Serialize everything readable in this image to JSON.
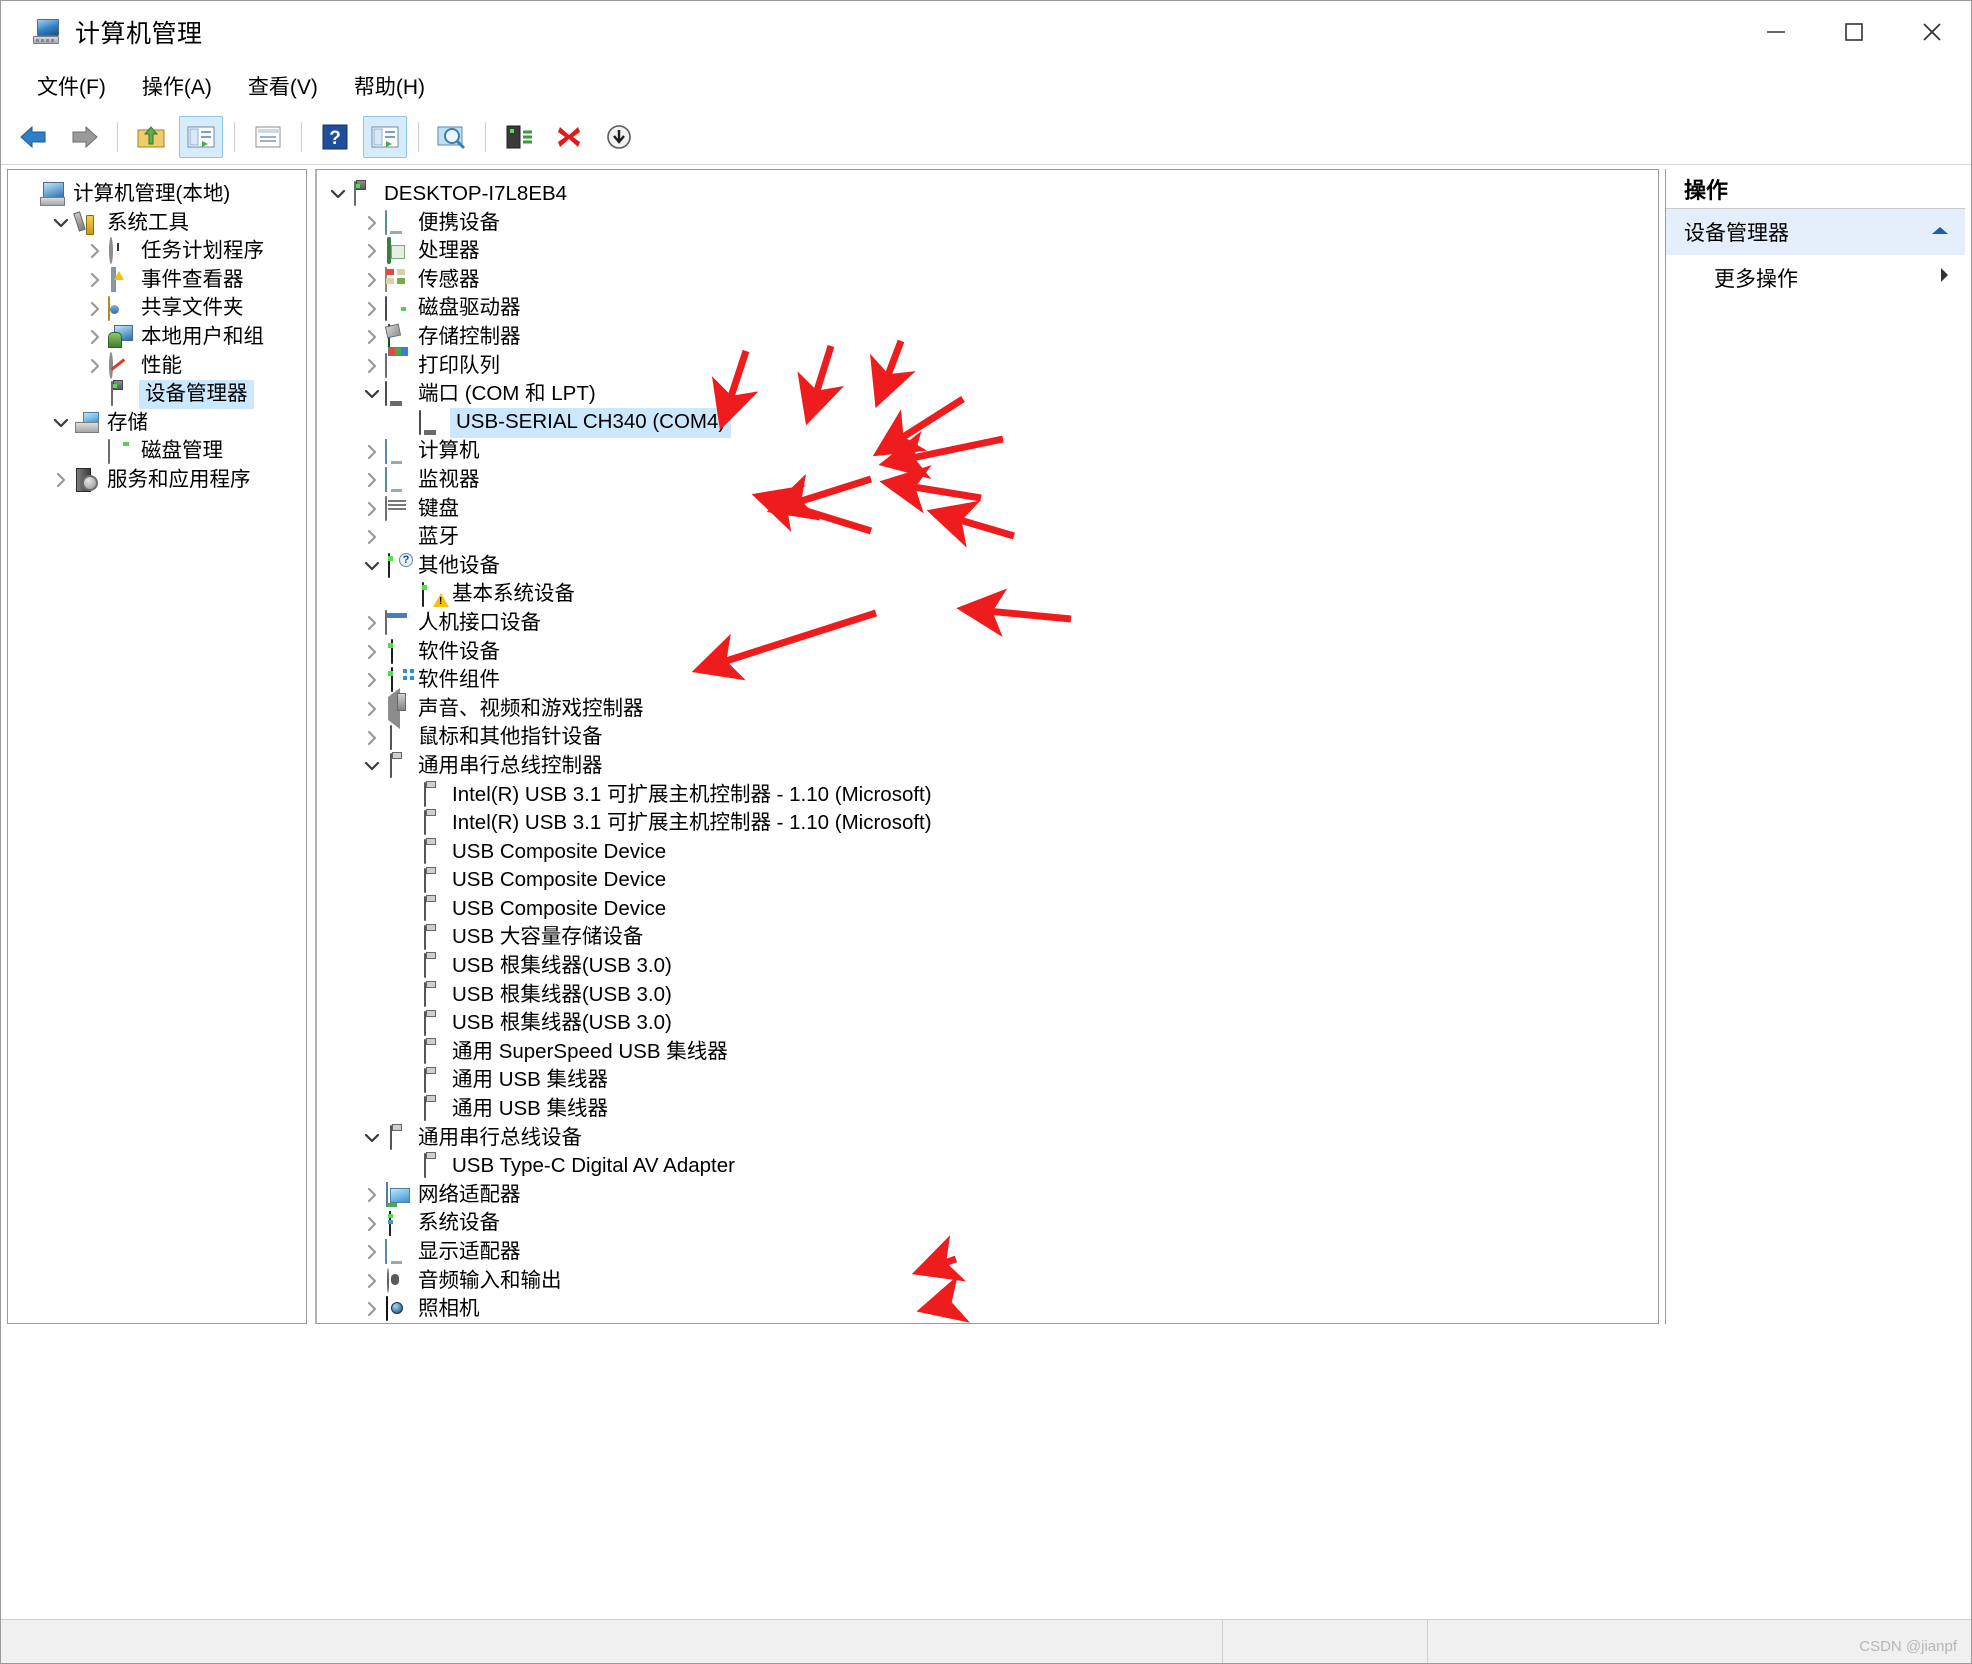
{
  "window": {
    "title": "计算机管理",
    "icon": "computer-management-icon",
    "minimize": "−",
    "maximize": "□",
    "close": "✕"
  },
  "menubar": {
    "items": [
      {
        "label": "文件(F)",
        "name": "menu-file"
      },
      {
        "label": "操作(A)",
        "name": "menu-action"
      },
      {
        "label": "查看(V)",
        "name": "menu-view"
      },
      {
        "label": "帮助(H)",
        "name": "menu-help"
      }
    ]
  },
  "toolbar": {
    "buttons": [
      {
        "name": "back-button",
        "icon": "arrow-left-icon",
        "active": false
      },
      {
        "name": "forward-button",
        "icon": "arrow-right-icon",
        "active": false
      },
      {
        "name": "up-one-level-button",
        "icon": "folder-up-icon",
        "active": false
      },
      {
        "name": "show-console-tree-button",
        "icon": "console-tree-icon",
        "active": true
      },
      {
        "name": "properties-button",
        "icon": "properties-window-icon",
        "active": false
      },
      {
        "name": "help-button",
        "icon": "question-mark-icon",
        "active": false
      },
      {
        "name": "show-hidden-devices-button",
        "icon": "list-view-icon",
        "active": true
      },
      {
        "name": "scan-hardware-changes-button",
        "icon": "magnifier-scan-icon",
        "active": false
      },
      {
        "name": "update-driver-button",
        "icon": "update-driver-icon",
        "active": false
      },
      {
        "name": "uninstall-device-button",
        "icon": "red-x-icon",
        "active": false
      },
      {
        "name": "disable-device-button",
        "icon": "down-arrow-circle-icon",
        "active": false
      }
    ]
  },
  "sidebar": {
    "items": [
      {
        "label": "计算机管理(本地)",
        "name": "sidebar-computer-management-local",
        "indent": 0,
        "chev": "none",
        "icon": "ic-cmgmt",
        "selected": false
      },
      {
        "label": "系统工具",
        "name": "sidebar-system-tools",
        "indent": 1,
        "chev": "down",
        "icon": "ic-tools",
        "selected": false
      },
      {
        "label": "任务计划程序",
        "name": "sidebar-task-scheduler",
        "indent": 2,
        "chev": "right",
        "icon": "ic-clock",
        "selected": false
      },
      {
        "label": "事件查看器",
        "name": "sidebar-event-viewer",
        "indent": 2,
        "chev": "right",
        "icon": "ic-event",
        "selected": false
      },
      {
        "label": "共享文件夹",
        "name": "sidebar-shared-folders",
        "indent": 2,
        "chev": "right",
        "icon": "ic-folder",
        "selected": false
      },
      {
        "label": "本地用户和组",
        "name": "sidebar-local-users-groups",
        "indent": 2,
        "chev": "right",
        "icon": "ic-users",
        "selected": false
      },
      {
        "label": "性能",
        "name": "sidebar-performance",
        "indent": 2,
        "chev": "right",
        "icon": "ic-perf",
        "selected": false
      },
      {
        "label": "设备管理器",
        "name": "sidebar-device-manager",
        "indent": 2,
        "chev": "none",
        "icon": "ic-devmgr",
        "selected": true
      },
      {
        "label": "存储",
        "name": "sidebar-storage",
        "indent": 1,
        "chev": "down",
        "icon": "ic-storage",
        "selected": false
      },
      {
        "label": "磁盘管理",
        "name": "sidebar-disk-management",
        "indent": 2,
        "chev": "none",
        "icon": "ic-diskmgmt",
        "selected": false
      },
      {
        "label": "服务和应用程序",
        "name": "sidebar-services-applications",
        "indent": 1,
        "chev": "right",
        "icon": "ic-services",
        "selected": false
      }
    ]
  },
  "device_tree": {
    "items": [
      {
        "label": "DESKTOP-I7L8EB4",
        "name": "device-node-desktop",
        "indent": 0,
        "chev": "down",
        "icon": "ic-devmgr",
        "selected": false
      },
      {
        "label": "便携设备",
        "name": "device-node-portable-devices",
        "indent": 1,
        "chev": "right",
        "icon": "ic-monitor",
        "selected": false
      },
      {
        "label": "处理器",
        "name": "device-node-processors",
        "indent": 1,
        "chev": "right",
        "icon": "ic-cpu",
        "selected": false
      },
      {
        "label": "传感器",
        "name": "device-node-sensors",
        "indent": 1,
        "chev": "right",
        "icon": "ic-sensor",
        "selected": false
      },
      {
        "label": "磁盘驱动器",
        "name": "device-node-disk-drives",
        "indent": 1,
        "chev": "right",
        "icon": "ic-disk",
        "selected": false
      },
      {
        "label": "存储控制器",
        "name": "device-node-storage-controllers",
        "indent": 1,
        "chev": "right",
        "icon": "ic-stgctl",
        "selected": false
      },
      {
        "label": "打印队列",
        "name": "device-node-print-queues",
        "indent": 1,
        "chev": "right",
        "icon": "ic-printer",
        "selected": false
      },
      {
        "label": "端口 (COM 和 LPT)",
        "name": "device-node-ports-com-lpt",
        "indent": 1,
        "chev": "down",
        "icon": "ic-serial",
        "selected": false
      },
      {
        "label": "USB-SERIAL CH340 (COM4)",
        "name": "device-node-usb-serial-ch340-com4",
        "indent": 2,
        "chev": "none",
        "icon": "ic-serial",
        "selected": true
      },
      {
        "label": "计算机",
        "name": "device-node-computer",
        "indent": 1,
        "chev": "right",
        "icon": "ic-display",
        "selected": false
      },
      {
        "label": "监视器",
        "name": "device-node-monitors",
        "indent": 1,
        "chev": "right",
        "icon": "ic-display",
        "selected": false
      },
      {
        "label": "键盘",
        "name": "device-node-keyboards",
        "indent": 1,
        "chev": "right",
        "icon": "ic-keyboard",
        "selected": false
      },
      {
        "label": "蓝牙",
        "name": "device-node-bluetooth",
        "indent": 1,
        "chev": "right",
        "icon": "ic-bt",
        "selected": false
      },
      {
        "label": "其他设备",
        "name": "device-node-other-devices",
        "indent": 1,
        "chev": "down",
        "icon": "ic-other-q",
        "selected": false
      },
      {
        "label": "基本系统设备",
        "name": "device-node-base-system-device",
        "indent": 2,
        "chev": "none",
        "icon": "ic-other-w",
        "selected": false
      },
      {
        "label": "人机接口设备",
        "name": "device-node-hid",
        "indent": 1,
        "chev": "right",
        "icon": "ic-hid",
        "selected": false
      },
      {
        "label": "软件设备",
        "name": "device-node-software-devices",
        "indent": 1,
        "chev": "right",
        "icon": "ic-softdev",
        "selected": false
      },
      {
        "label": "软件组件",
        "name": "device-node-software-components",
        "indent": 1,
        "chev": "right",
        "icon": "ic-softcomp",
        "selected": false
      },
      {
        "label": "声音、视频和游戏控制器",
        "name": "device-node-sound-video-game-controllers",
        "indent": 1,
        "chev": "right",
        "icon": "ic-sound",
        "selected": false
      },
      {
        "label": "鼠标和其他指针设备",
        "name": "device-node-mice-pointing-devices",
        "indent": 1,
        "chev": "right",
        "icon": "ic-mouse",
        "selected": false
      },
      {
        "label": "通用串行总线控制器",
        "name": "device-node-usb-controllers",
        "indent": 1,
        "chev": "down",
        "icon": "ic-usbport",
        "selected": false
      },
      {
        "label": "Intel(R) USB 3.1 可扩展主机控制器 - 1.10 (Microsoft)",
        "name": "device-node-intel-usb31-xhci-1",
        "indent": 2,
        "chev": "none",
        "icon": "ic-usbport",
        "selected": false
      },
      {
        "label": "Intel(R) USB 3.1 可扩展主机控制器 - 1.10 (Microsoft)",
        "name": "device-node-intel-usb31-xhci-2",
        "indent": 2,
        "chev": "none",
        "icon": "ic-usbport",
        "selected": false
      },
      {
        "label": "USB Composite Device",
        "name": "device-node-usb-composite-1",
        "indent": 2,
        "chev": "none",
        "icon": "ic-usbport",
        "selected": false
      },
      {
        "label": "USB Composite Device",
        "name": "device-node-usb-composite-2",
        "indent": 2,
        "chev": "none",
        "icon": "ic-usbport",
        "selected": false
      },
      {
        "label": "USB Composite Device",
        "name": "device-node-usb-composite-3",
        "indent": 2,
        "chev": "none",
        "icon": "ic-usbport",
        "selected": false
      },
      {
        "label": "USB 大容量存储设备",
        "name": "device-node-usb-mass-storage",
        "indent": 2,
        "chev": "none",
        "icon": "ic-usbport",
        "selected": false
      },
      {
        "label": "USB 根集线器(USB 3.0)",
        "name": "device-node-usb-root-hub-1",
        "indent": 2,
        "chev": "none",
        "icon": "ic-usbport",
        "selected": false
      },
      {
        "label": "USB 根集线器(USB 3.0)",
        "name": "device-node-usb-root-hub-2",
        "indent": 2,
        "chev": "none",
        "icon": "ic-usbport",
        "selected": false
      },
      {
        "label": "USB 根集线器(USB 3.0)",
        "name": "device-node-usb-root-hub-3",
        "indent": 2,
        "chev": "none",
        "icon": "ic-usbport",
        "selected": false
      },
      {
        "label": "通用 SuperSpeed USB 集线器",
        "name": "device-node-generic-superspeed-usb-hub",
        "indent": 2,
        "chev": "none",
        "icon": "ic-usbport",
        "selected": false
      },
      {
        "label": "通用 USB 集线器",
        "name": "device-node-generic-usb-hub-1",
        "indent": 2,
        "chev": "none",
        "icon": "ic-usbport",
        "selected": false
      },
      {
        "label": "通用 USB 集线器",
        "name": "device-node-generic-usb-hub-2",
        "indent": 2,
        "chev": "none",
        "icon": "ic-usbport",
        "selected": false
      },
      {
        "label": "通用串行总线设备",
        "name": "device-node-usb-devices",
        "indent": 1,
        "chev": "down",
        "icon": "ic-usbport",
        "selected": false
      },
      {
        "label": "USB Type-C Digital AV Adapter",
        "name": "device-node-usb-typec-av-adapter",
        "indent": 2,
        "chev": "none",
        "icon": "ic-usbport",
        "selected": false
      },
      {
        "label": "网络适配器",
        "name": "device-node-network-adapters",
        "indent": 1,
        "chev": "right",
        "icon": "ic-net",
        "selected": false
      },
      {
        "label": "系统设备",
        "name": "device-node-system-devices",
        "indent": 1,
        "chev": "right",
        "icon": "ic-sysdev",
        "selected": false
      },
      {
        "label": "显示适配器",
        "name": "device-node-display-adapters",
        "indent": 1,
        "chev": "right",
        "icon": "ic-display",
        "selected": false
      },
      {
        "label": "音频输入和输出",
        "name": "device-node-audio-inputs-outputs",
        "indent": 1,
        "chev": "right",
        "icon": "ic-audioio",
        "selected": false
      },
      {
        "label": "照相机",
        "name": "device-node-cameras",
        "indent": 1,
        "chev": "right",
        "icon": "ic-camera",
        "selected": false
      }
    ]
  },
  "actions_pane": {
    "header": "操作",
    "rows": [
      {
        "label": "设备管理器",
        "name": "actions-device-manager",
        "sub": false,
        "marker": "collapse-arrow",
        "highlight": true
      },
      {
        "label": "更多操作",
        "name": "actions-more-actions",
        "sub": true,
        "marker": "submenu-arrow",
        "highlight": false
      }
    ]
  },
  "annotations": {
    "watermark": "CSDN @jianpf",
    "arrow_color": "#ee1c1c",
    "arrow_count": 12
  },
  "colors": {
    "selection_highlight": "#cce8ff",
    "toolbar_active": "#d6ecfb",
    "actions_highlight": "#e4effb",
    "window_border": "#9a9a9a",
    "statusbar_bg": "#f0f0f0"
  }
}
